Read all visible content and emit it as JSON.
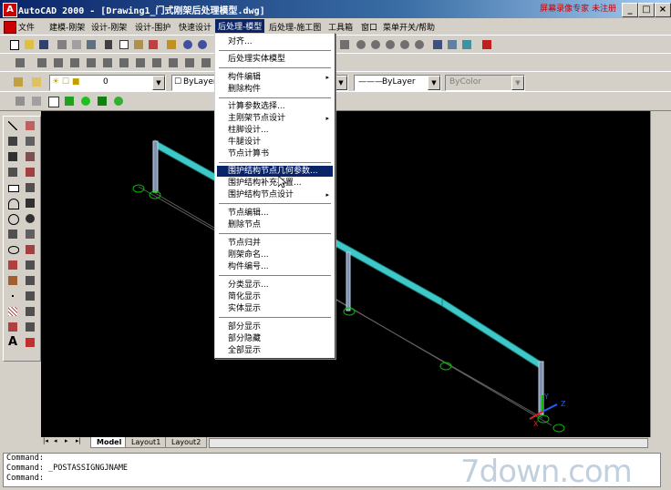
{
  "titlebar": {
    "title": "AutoCAD 2000 - [Drawing1_门式刚架后处理模型.dwg]",
    "btn_min": "_",
    "btn_max": "□",
    "btn_close": "×"
  },
  "menubar": {
    "items": [
      "文件",
      "建模-刚架",
      "设计-刚架",
      "设计-围护",
      "快速设计",
      "后处理-模型",
      "后处理-施工图",
      "工具箱",
      "窗口",
      "菜单开关/帮助"
    ],
    "active_index": 5,
    "red_note": "屏幕录像专家 未注册"
  },
  "properties": {
    "layer": "0",
    "color": "ByLayer",
    "linetype": "ByLayer",
    "lineweight": "ByColor"
  },
  "dropdown": {
    "items": [
      {
        "label": "对齐...",
        "sub": false
      },
      {
        "label": "后处理实体模型",
        "sub": false
      },
      {
        "label": "构件编辑",
        "sub": true
      },
      {
        "label": "删除构件",
        "sub": false
      },
      {
        "label": "计算参数选择...",
        "sub": false
      },
      {
        "label": "主刚架节点设计",
        "sub": true
      },
      {
        "label": "柱脚设计...",
        "sub": false
      },
      {
        "label": "牛腿设计",
        "sub": false
      },
      {
        "label": "节点计算书",
        "sub": false
      },
      {
        "label": "围护结构节点几何参数...",
        "sub": false
      },
      {
        "label": "围护结构补充布置...",
        "sub": false
      },
      {
        "label": "围护结构节点设计",
        "sub": true
      },
      {
        "label": "节点编辑...",
        "sub": false
      },
      {
        "label": "删除节点",
        "sub": false
      },
      {
        "label": "节点归并",
        "sub": false
      },
      {
        "label": "刚架命名...",
        "sub": false
      },
      {
        "label": "构件编号...",
        "sub": false
      },
      {
        "label": "分类显示...",
        "sub": false
      },
      {
        "label": "简化显示",
        "sub": false
      },
      {
        "label": "实体显示",
        "sub": false
      },
      {
        "label": "部分显示",
        "sub": false
      },
      {
        "label": "部分隐藏",
        "sub": false
      },
      {
        "label": "全部显示",
        "sub": false
      }
    ],
    "highlighted_index": 9,
    "sub_arrow": "▸"
  },
  "layout_tabs": [
    "Model",
    "Layout1",
    "Layout2"
  ],
  "nav_arrows": [
    "|◂",
    "◂",
    "▸",
    "▸|"
  ],
  "command_lines": [
    "Command:",
    "Command: _POSTASSIGNGJNAME",
    "Command:"
  ],
  "ucs": {
    "y": "Y",
    "z": "Z",
    "x": "X"
  },
  "watermark": "7down.com",
  "left_tool_letter": "A"
}
